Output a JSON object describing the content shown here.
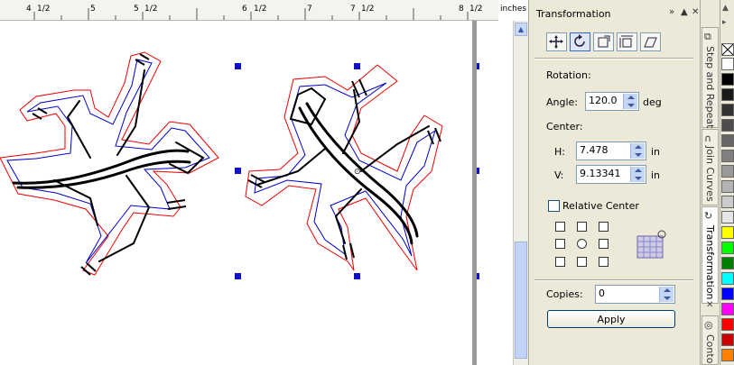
{
  "ruler": {
    "units": "inches",
    "labels": [
      "4",
      "1/2",
      "5",
      "5",
      "1/2",
      "6",
      "1/2",
      "7",
      "7",
      "1/2",
      "8",
      "1/2"
    ]
  },
  "docker": {
    "title": "Transformation",
    "rotation_heading": "Rotation:",
    "angle_label": "Angle:",
    "angle_value": "120.0",
    "angle_unit": "deg",
    "center_heading": "Center:",
    "h_label": "H:",
    "h_value": "7.478",
    "h_unit": "in",
    "v_label": "V:",
    "v_value": "9.13341",
    "v_unit": "in",
    "relative_center_label": "Relative Center",
    "relative_center_checked": false,
    "copies_label": "Copies:",
    "copies_value": "0",
    "apply_label": "Apply",
    "mode_buttons": [
      "position-icon",
      "rotate-icon",
      "scale-icon",
      "size-icon",
      "skew-icon"
    ],
    "active_mode": "rotate-icon"
  },
  "tabs": [
    {
      "label": "Step and Repeat",
      "icon": "step-repeat-icon"
    },
    {
      "label": "Join Curves",
      "icon": "join-curves-icon"
    },
    {
      "label": "Transformation",
      "icon": "transformation-icon",
      "active": true
    },
    {
      "label": "Conto",
      "icon": "contour-icon"
    }
  ],
  "palette_colors": [
    "#ffffff",
    "#000000",
    "#1a1a1a",
    "#333333",
    "#4d4d4d",
    "#666666",
    "#808080",
    "#999999",
    "#b3b3b3",
    "#cccccc",
    "#e6e6e6",
    "#ffff00",
    "#00ff00",
    "#008000",
    "#00ffff",
    "#0000ff",
    "#ff00ff",
    "#ff0000",
    "#cc0000",
    "#ff8000"
  ],
  "colors": {
    "outer_contour": "#ee0000",
    "inner_contour": "#0000cc",
    "lizard": "#000000",
    "selection_handle": "#1010c8"
  }
}
